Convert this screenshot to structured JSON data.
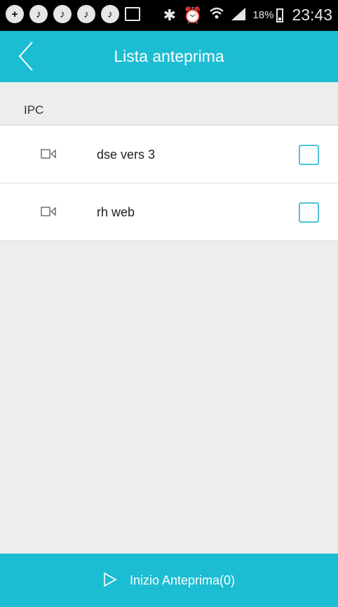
{
  "status_bar": {
    "battery": "18%",
    "time": "23:43",
    "notification_icons": [
      "plus-badge-icon",
      "notif-circle-icon",
      "notif-circle-icon",
      "notif-circle-icon",
      "notif-circle-icon",
      "image-icon"
    ],
    "system_icons": [
      "bluetooth-icon",
      "alarm-icon",
      "wifi-icon",
      "signal-icon"
    ]
  },
  "header": {
    "title": "Lista anteprima",
    "back_icon": "chevron-left-icon"
  },
  "section": {
    "label": "IPC"
  },
  "devices": [
    {
      "name": "dse vers 3",
      "icon": "camera-icon",
      "checked": false
    },
    {
      "name": "rh web",
      "icon": "camera-icon",
      "checked": false
    }
  ],
  "footer": {
    "label": "Inizio Anteprima(0)",
    "icon": "play-icon"
  },
  "colors": {
    "accent": "#1cbdd2",
    "background": "#ededed",
    "checkbox_border": "#4fc3d6"
  }
}
